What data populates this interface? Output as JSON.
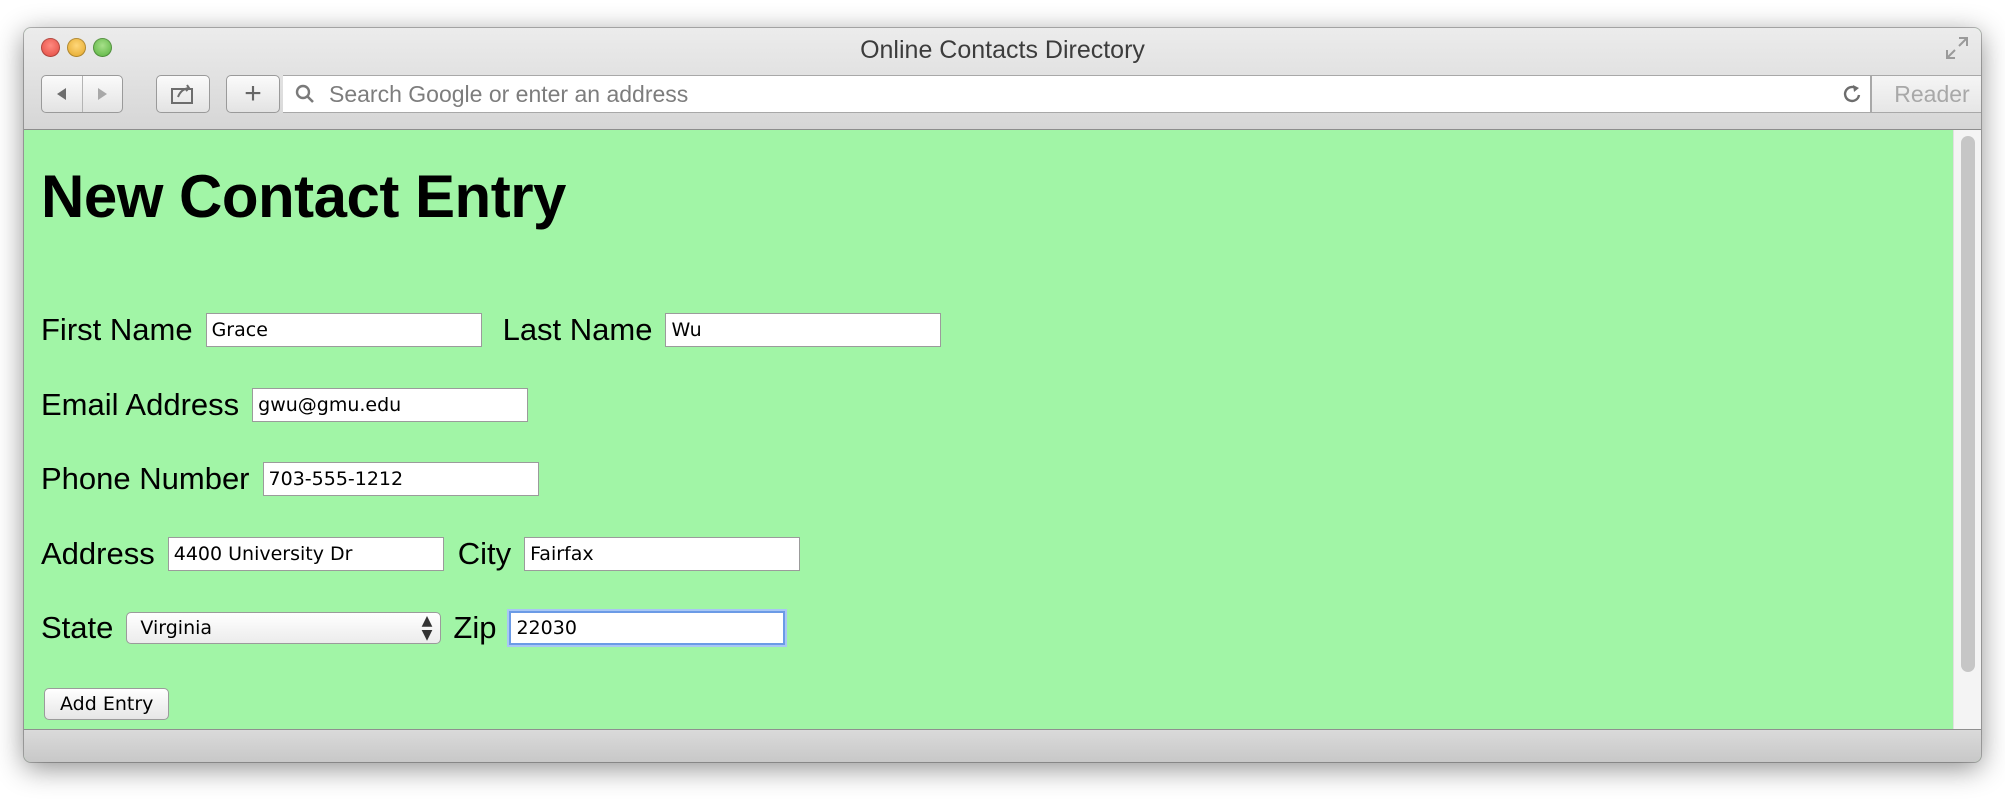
{
  "window": {
    "title": "Online Contacts Directory"
  },
  "toolbar": {
    "address_placeholder": "Search Google or enter an address",
    "reader_label": "Reader",
    "new_tab_label": "+"
  },
  "page": {
    "title": "New Contact Entry",
    "background_color": "#a1f5a6"
  },
  "form": {
    "first_name": {
      "label": "First Name",
      "value": "Grace"
    },
    "last_name": {
      "label": "Last Name",
      "value": "Wu"
    },
    "email": {
      "label": "Email Address",
      "value": "gwu@gmu.edu"
    },
    "phone": {
      "label": "Phone Number",
      "value": "703-555-1212"
    },
    "address": {
      "label": "Address",
      "value": "4400 University Dr"
    },
    "city": {
      "label": "City",
      "value": "Fairfax"
    },
    "state": {
      "label": "State",
      "selected": "Virginia"
    },
    "zip": {
      "label": "Zip",
      "value": "22030"
    },
    "submit_label": "Add Entry"
  },
  "icons": {
    "close": "close-window-icon",
    "minimize": "minimize-window-icon",
    "zoom": "zoom-window-icon",
    "fullscreen": "fullscreen-icon",
    "back": "back-arrow-icon",
    "forward": "forward-arrow-icon",
    "share": "share-icon",
    "search": "search-icon",
    "reload": "reload-icon"
  }
}
